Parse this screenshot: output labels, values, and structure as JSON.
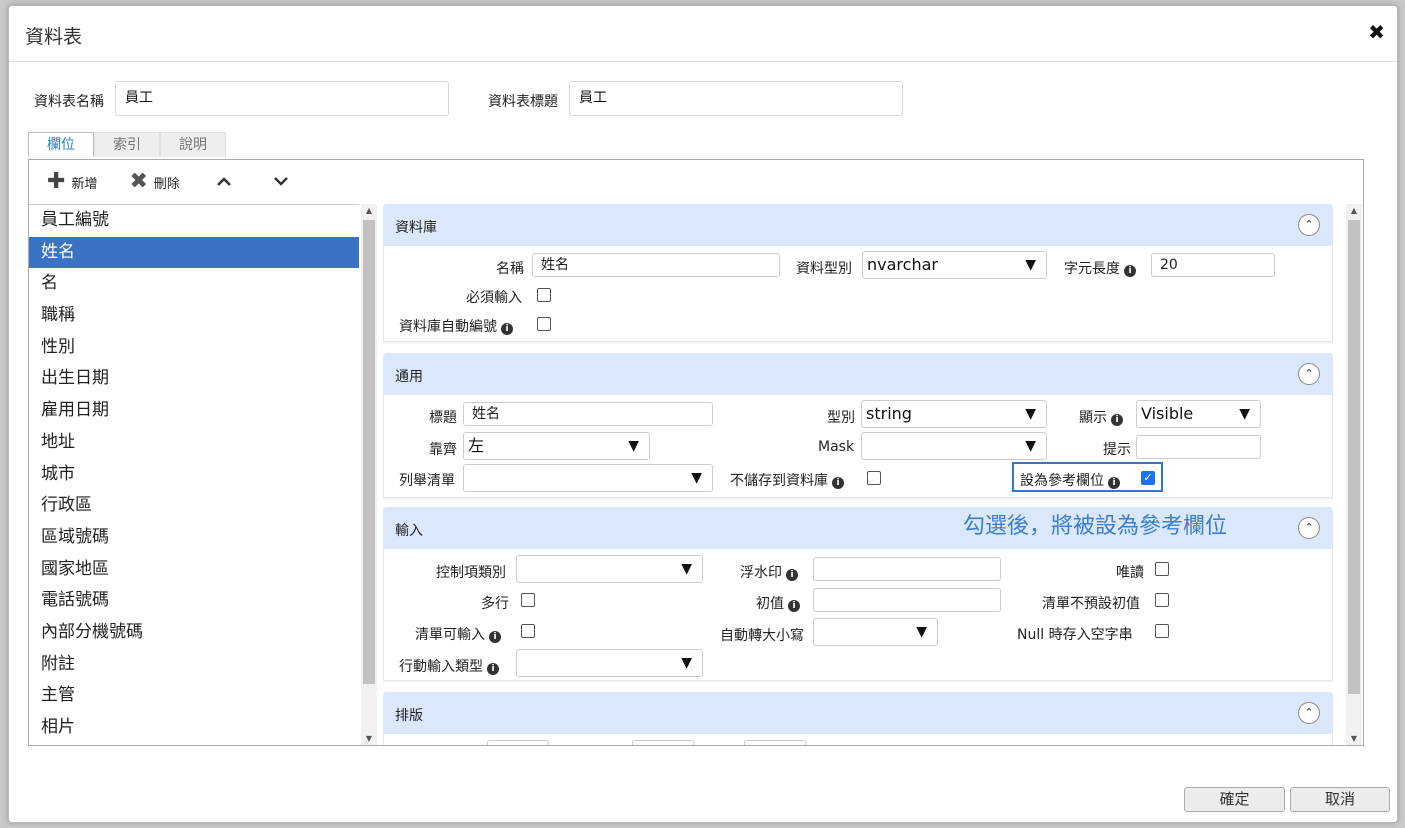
{
  "dialog": {
    "title": "資料表",
    "close": "✖"
  },
  "header": {
    "name_label": "資料表名稱",
    "name_value": "員工",
    "caption_label": "資料表標題",
    "caption_value": "員工"
  },
  "tabs": [
    {
      "label": "欄位"
    },
    {
      "label": "索引"
    },
    {
      "label": "說明"
    }
  ],
  "toolbar": {
    "add_label": "新增",
    "delete_label": "刪除",
    "up": "⌃",
    "down": "⌄"
  },
  "fields": [
    "員工編號",
    "姓名",
    "名",
    "職稱",
    "性別",
    "出生日期",
    "雇用日期",
    "地址",
    "城市",
    "行政區",
    "區域號碼",
    "國家地區",
    "電話號碼",
    "內部分機號碼",
    "附註",
    "主管",
    "相片"
  ],
  "selected_field": "姓名",
  "sections": {
    "database": {
      "title": "資料庫",
      "name_label": "名稱",
      "name_value": "姓名",
      "datatype_label": "資料型別",
      "datatype_value": "nvarchar",
      "length_label": "字元長度",
      "length_value": "20",
      "required_label": "必須輸入",
      "autonum_label": "資料庫自動編號"
    },
    "general": {
      "title": "通用",
      "caption_label": "標題",
      "caption_value": "姓名",
      "type_label": "型別",
      "type_value": "string",
      "display_label": "顯示",
      "display_value": "Visible",
      "align_label": "靠齊",
      "align_value": "左",
      "mask_label": "Mask",
      "mask_value": "",
      "hint_label": "提示",
      "hint_value": "",
      "enum_label": "列舉清單",
      "enum_value": "",
      "nostore_label": "不儲存到資料庫",
      "ref_label": "設為參考欄位",
      "ref_checked": true
    },
    "input": {
      "title": "輸入",
      "annotation": "勾選後，將被設為參考欄位",
      "control_label": "控制項類別",
      "control_value": "",
      "watermark_label": "浮水印",
      "watermark_value": "",
      "readonly_label": "唯讀",
      "multiline_label": "多行",
      "default_label": "初值",
      "default_value": "",
      "nodefault_label": "清單不預設初值",
      "listinput_label": "清單可輸入",
      "case_label": "自動轉大小寫",
      "case_value": "",
      "nullempty_label": "Null 時存入空字串",
      "mobile_label": "行動輸入類型",
      "mobile_value": ""
    },
    "layout": {
      "title": "排版"
    }
  },
  "buttons": {
    "ok": "確定",
    "cancel": "取消"
  },
  "icons": {
    "info": "i",
    "toggle": "⌃",
    "dropdown": "▼",
    "plus": "✚",
    "x": "✖"
  },
  "colors": {
    "accent": "#3a72c4",
    "section_header": "#dbe8fb",
    "annotation": "#3a7fc8"
  }
}
